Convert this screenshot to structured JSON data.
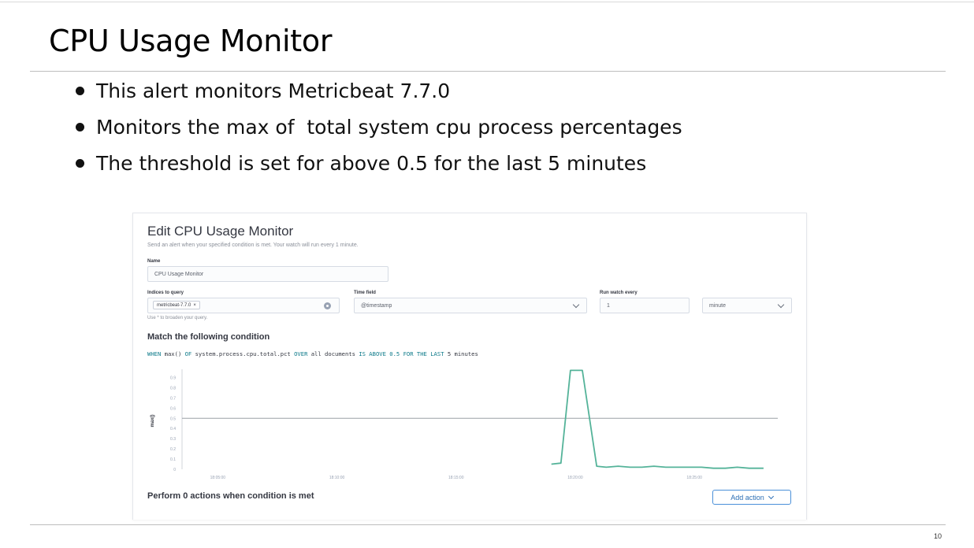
{
  "slide": {
    "title": "CPU Usage Monitor",
    "bullets": [
      "This alert monitors Metricbeat 7.7.0",
      "Monitors the max of  total system cpu process percentages",
      "The threshold is set for above 0.5 for the last 5 minutes"
    ],
    "page_number": "10"
  },
  "panel": {
    "title": "Edit CPU Usage Monitor",
    "description": "Send an alert when your specified condition is met. Your watch will run every 1 minute.",
    "name_label": "Name",
    "name_value": "CPU Usage Monitor",
    "indices_label": "Indices to query",
    "index_tag": "metricbeat-7.7.0",
    "index_tag_remove": "×",
    "indices_hint": "Use * to broaden your query.",
    "time_field_label": "Time field",
    "time_field_value": "@timestamp",
    "run_watch_label": "Run watch every",
    "run_watch_value": "1",
    "run_watch_unit": "minute",
    "condition_heading": "Match the following condition",
    "condition": {
      "when": "WHEN",
      "agg": "max()",
      "of": "OF",
      "field": "system.process.cpu.total.pct",
      "over": "OVER",
      "over_value": "all documents",
      "is_above": "IS ABOVE",
      "threshold": "0.5",
      "for_the_last": "FOR THE LAST",
      "window": "5 minutes"
    },
    "actions_heading": "Perform 0 actions when condition is met",
    "add_action_label": "Add action"
  },
  "chart_data": {
    "type": "line",
    "ylabel": "max()",
    "yticks": [
      "0",
      "0.1",
      "0.2",
      "0.3",
      "0.4",
      "0.5",
      "0.6",
      "0.7",
      "0.8",
      "0.9"
    ],
    "ylim": [
      0,
      0.95
    ],
    "xticks": [
      "18:05:00",
      "18:10:00",
      "18:15:00",
      "18:20:00",
      "18:25:00"
    ],
    "xlim_minutes": [
      16.0,
      41.0
    ],
    "xtick_minutes": [
      17.5,
      22.5,
      27.5,
      32.5,
      37.5
    ],
    "threshold": 0.5,
    "series": [
      {
        "color": "#54b399",
        "x_minutes": [
          31.5,
          31.9,
          32.3,
          32.6,
          32.8,
          33.4,
          33.8,
          34.3,
          34.8,
          35.3,
          35.8,
          36.3,
          36.8,
          37.3,
          37.8,
          38.3,
          38.8,
          39.3,
          39.8,
          40.4
        ],
        "y": [
          0.05,
          0.06,
          0.97,
          0.97,
          0.97,
          0.03,
          0.02,
          0.03,
          0.02,
          0.02,
          0.03,
          0.02,
          0.02,
          0.02,
          0.02,
          0.01,
          0.01,
          0.02,
          0.01,
          0.01
        ]
      }
    ],
    "grid": false
  },
  "colors": {
    "series": "#54b399",
    "threshold_line": "#9aa0a6",
    "keyword": "#0d7a8a",
    "button_accent": "#2c6fb5"
  }
}
